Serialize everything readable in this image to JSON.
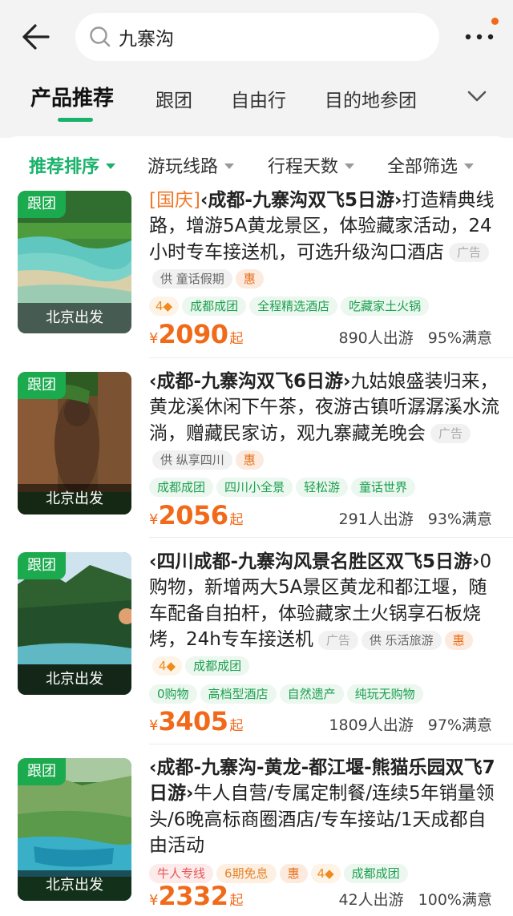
{
  "search": {
    "value": "九寨沟"
  },
  "tabs": [
    {
      "label": "产品推荐"
    },
    {
      "label": "跟团"
    },
    {
      "label": "自由行"
    },
    {
      "label": "目的地参团"
    }
  ],
  "filters": [
    {
      "label": "推荐排序"
    },
    {
      "label": "游玩线路"
    },
    {
      "label": "行程天数"
    },
    {
      "label": "全部筛选"
    }
  ],
  "colors": {
    "accent": "#19b26b",
    "price": "#f06a1a",
    "badge": "#1caa4e"
  },
  "products": [
    {
      "badge": "跟团",
      "depart": "北京出发",
      "tag": "[国庆]",
      "name": "‹成都-九寨沟双飞5日游›",
      "desc": "打造精典线路，增游5A黄龙景区，体验藏家活动，24小时专车接送机，可选升级沟口酒店",
      "ad": "广告",
      "supplier": "童话假期",
      "hui": "惠",
      "stars": "4",
      "tags": [
        "成都成团",
        "全程精选酒店",
        "吃藏家土火锅"
      ],
      "currency": "¥",
      "price": "2090",
      "price_suffix": "起",
      "travelers": "890人出游",
      "satisfaction": "95%满意"
    },
    {
      "badge": "跟团",
      "depart": "北京出发",
      "name": "‹成都-九寨沟双飞6日游›",
      "desc": "九姑娘盛装归来，黄龙溪休闲下午茶，夜游古镇听潺潺溪水流淌，赠藏民家访，观九寨藏羌晚会",
      "ad": "广告",
      "supplier": "纵享四川",
      "hui": "惠",
      "tags": [
        "成都成团",
        "四川小全景",
        "轻松游",
        "童话世界"
      ],
      "currency": "¥",
      "price": "2056",
      "price_suffix": "起",
      "travelers": "291人出游",
      "satisfaction": "93%满意"
    },
    {
      "badge": "跟团",
      "depart": "北京出发",
      "name": "‹四川成都-九寨沟风景名胜区双飞5日游›",
      "desc": "0购物，新增两大5A景区黄龙和都江堰，随车配备自拍杆，体验藏家土火锅享石板烧烤，24h专车接送机",
      "ad": "广告",
      "supplier": "乐活旅游",
      "hui": "惠",
      "stars": "4",
      "inline_tag": "成都成团",
      "tags": [
        "0购物",
        "高档型酒店",
        "自然遗产",
        "纯玩无购物"
      ],
      "currency": "¥",
      "price": "3405",
      "price_suffix": "起",
      "travelers": "1809人出游",
      "satisfaction": "97%满意"
    },
    {
      "badge": "跟团",
      "depart": "北京出发",
      "name": "‹成都-九寨沟-黄龙-都江堰-熊猫乐园双飞7日游›",
      "desc": "牛人自营/专属定制餐/连续5年销量领头/6晚高标商圈酒店/专车接站/1天成都自由活动",
      "tag_red": "牛人专线",
      "tag_orange": "6期免息",
      "hui": "惠",
      "stars": "4",
      "tags": [
        "成都成团"
      ],
      "currency": "¥",
      "price": "2332",
      "price_suffix": "起",
      "travelers": "42人出游",
      "satisfaction": "100%满意"
    }
  ]
}
